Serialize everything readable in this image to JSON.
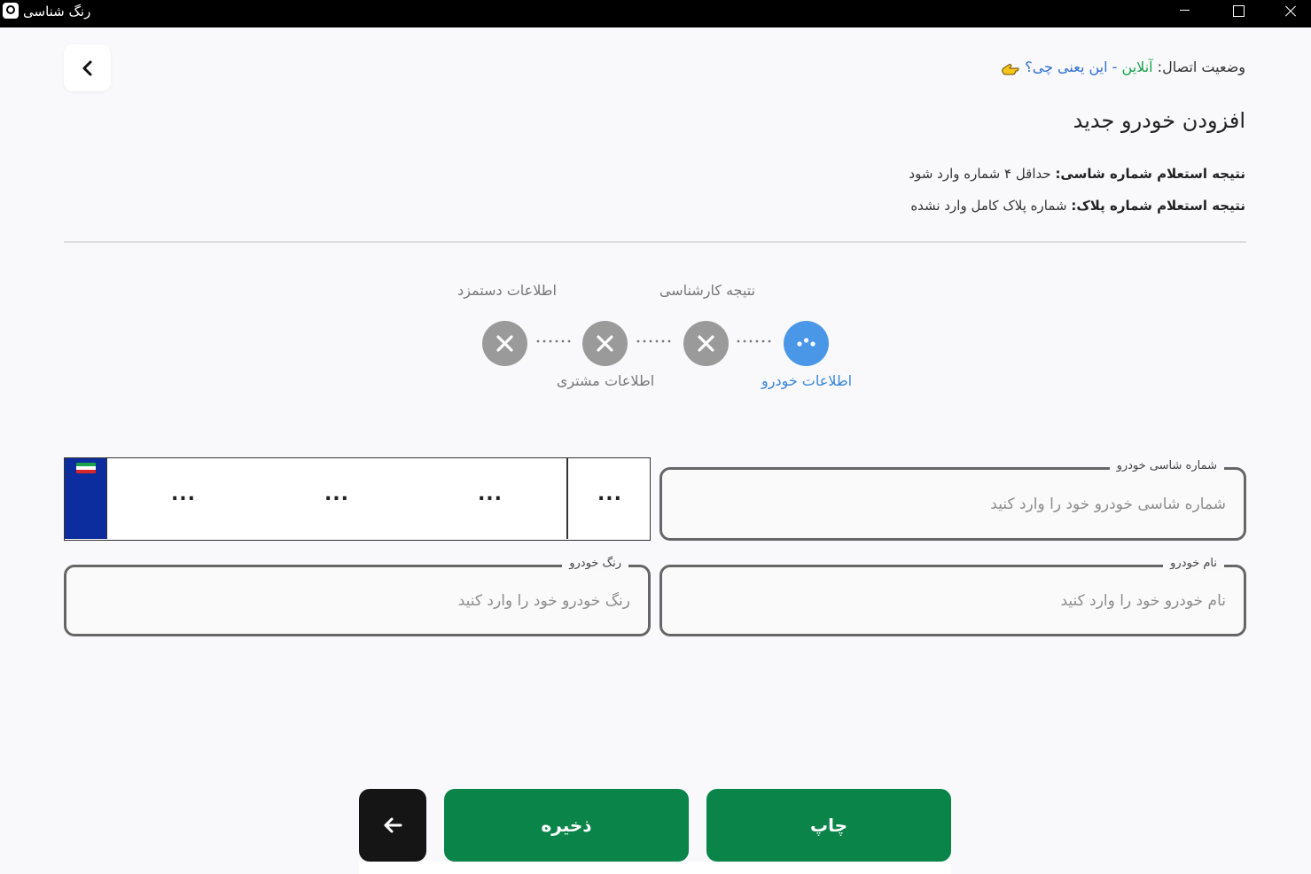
{
  "window": {
    "title": "رنگ شناسی"
  },
  "status": {
    "label": "وضعیت اتصال: ",
    "value": "آنلاین",
    "separator": " - ",
    "help_link": "این یعنی چی؟"
  },
  "page": {
    "title": "افزودن خودرو جدید"
  },
  "info": {
    "chassis_label": "نتیجه استعلام شماره شاسی:",
    "chassis_value": " حداقل ۴ شماره وارد شود",
    "plate_label": "نتیجه استعلام شماره پلاک:",
    "plate_value": " شماره پلاک کامل وارد نشده"
  },
  "stepper": {
    "steps": [
      {
        "label": "اطلاعات خودرو",
        "state": "active"
      },
      {
        "label": "نتیجه کارشناسی",
        "state": "inactive"
      },
      {
        "label": "اطلاعات مشتری",
        "state": "inactive"
      },
      {
        "label": "اطلاعات دستمزد",
        "state": "inactive"
      }
    ]
  },
  "form": {
    "chassis": {
      "label": "شماره شاسی خودرو",
      "placeholder": "شماره شاسی خودرو خود را وارد کنید",
      "value": ""
    },
    "name": {
      "label": "نام خودرو",
      "placeholder": "نام خودرو خود را وارد کنید",
      "value": ""
    },
    "color": {
      "label": "رنگ خودرو",
      "placeholder": "رنگ خودرو خود را وارد کنید",
      "value": ""
    },
    "plate": {
      "segments": [
        "...",
        "...",
        "...",
        "..."
      ]
    }
  },
  "buttons": {
    "print": "چاپ",
    "save": "ذخیره"
  },
  "colors": {
    "primary_green": "#0a8449",
    "active_blue": "#4a97e8",
    "online_green": "#17a34a",
    "link_blue": "#2f6fd0",
    "inactive_gray": "#9a9a9a",
    "plate_blue": "#0c2d9e"
  },
  "icons": {
    "back_top": "chevron-left-icon",
    "back_bottom": "arrow-left-icon",
    "step_inactive": "close-icon",
    "step_active": "more-dots-icon",
    "help": "pointing-hand-icon"
  }
}
